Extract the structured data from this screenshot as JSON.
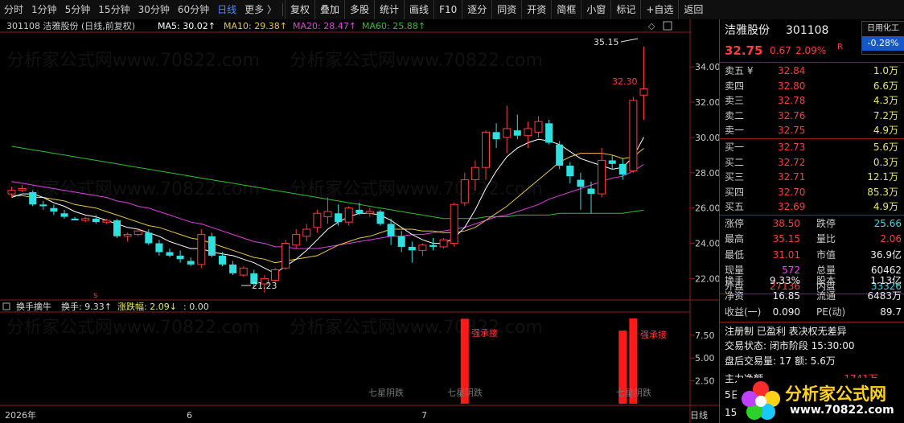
{
  "toolbar": {
    "periods": [
      "分时",
      "1分钟",
      "5分钟",
      "15分钟",
      "30分钟",
      "60分钟",
      "日线",
      "更多 〉"
    ],
    "active_period": "日线",
    "buttons": [
      "复权",
      "叠加",
      "多股",
      "统计",
      "画线",
      "F10",
      "逐分",
      "同资",
      "开资",
      "简框",
      "小窗",
      "标记",
      "+自选",
      "返回"
    ]
  },
  "chart_header": {
    "title": "301108 洁雅股份 (日线,前复权)",
    "ma5": "MA5: 30.02↑",
    "ma10": "MA10: 29.38↑",
    "ma20": "MA20: 28.47↑",
    "ma60": "MA60: 25.88↑"
  },
  "watermark": "分析家公式网www.70822.com",
  "annotations": {
    "high": "35.15",
    "low": "21.23",
    "limit_up": "32.30",
    "s_marker": "s"
  },
  "indicator_header": {
    "name": "换手擒牛",
    "turnover": "换手: 9.33↑",
    "change": "涨跌幅: 2.09↓",
    "blank": ": 0.00"
  },
  "indicator_labels": {
    "strong_accept": "强承接",
    "dark_star": "七星阴跌"
  },
  "x_axis": {
    "labels": [
      "2026年",
      "6",
      "7"
    ],
    "period_label": "日线"
  },
  "colors": {
    "up": "#ff3c3c",
    "down": "#2fe0e0",
    "ma5": "#ffffff",
    "ma10": "#e8c840",
    "ma20": "#e040e0",
    "ma60": "#30c030"
  },
  "chart_data": [
    {
      "type": "candlestick",
      "y_ticks": [
        "34.00",
        "32.00",
        "30.00",
        "28.00",
        "26.00",
        "24.00",
        "22.00"
      ],
      "ylim": [
        21.2,
        35.6
      ],
      "candles": [
        {
          "o": 26.8,
          "h": 27.2,
          "l": 26.6,
          "c": 27.0
        },
        {
          "o": 27.0,
          "h": 27.3,
          "l": 26.9,
          "c": 27.1
        },
        {
          "o": 26.9,
          "h": 27.0,
          "l": 26.1,
          "c": 26.2
        },
        {
          "o": 26.2,
          "h": 26.4,
          "l": 25.9,
          "c": 26.1
        },
        {
          "o": 26.0,
          "h": 26.2,
          "l": 25.6,
          "c": 25.8
        },
        {
          "o": 25.7,
          "h": 25.9,
          "l": 25.4,
          "c": 25.5
        },
        {
          "o": 25.4,
          "h": 25.5,
          "l": 25.3,
          "c": 25.3
        },
        {
          "o": 25.3,
          "h": 25.5,
          "l": 25.2,
          "c": 25.4
        },
        {
          "o": 25.4,
          "h": 25.6,
          "l": 25.1,
          "c": 25.2
        },
        {
          "o": 25.2,
          "h": 25.4,
          "l": 25.1,
          "c": 25.3
        },
        {
          "o": 25.3,
          "h": 25.4,
          "l": 24.3,
          "c": 24.4
        },
        {
          "o": 24.4,
          "h": 24.6,
          "l": 24.1,
          "c": 24.5
        },
        {
          "o": 24.5,
          "h": 24.8,
          "l": 24.4,
          "c": 24.7
        },
        {
          "o": 24.6,
          "h": 24.8,
          "l": 23.9,
          "c": 24.0
        },
        {
          "o": 24.0,
          "h": 24.2,
          "l": 23.3,
          "c": 23.5
        },
        {
          "o": 23.5,
          "h": 23.7,
          "l": 23.2,
          "c": 23.3
        },
        {
          "o": 23.3,
          "h": 23.6,
          "l": 22.9,
          "c": 23.1
        },
        {
          "o": 23.0,
          "h": 23.2,
          "l": 22.7,
          "c": 22.8
        },
        {
          "o": 22.8,
          "h": 24.8,
          "l": 22.6,
          "c": 24.5
        },
        {
          "o": 24.4,
          "h": 24.6,
          "l": 23.2,
          "c": 23.3
        },
        {
          "o": 23.3,
          "h": 23.5,
          "l": 22.7,
          "c": 22.8
        },
        {
          "o": 22.8,
          "h": 23.0,
          "l": 22.2,
          "c": 22.3
        },
        {
          "o": 22.2,
          "h": 22.7,
          "l": 22.1,
          "c": 22.6
        },
        {
          "o": 22.3,
          "h": 22.5,
          "l": 21.5,
          "c": 21.7
        },
        {
          "o": 21.7,
          "h": 22.2,
          "l": 21.2,
          "c": 22.0
        },
        {
          "o": 21.9,
          "h": 22.6,
          "l": 21.8,
          "c": 22.5
        },
        {
          "o": 22.6,
          "h": 24.2,
          "l": 22.5,
          "c": 24.0
        },
        {
          "o": 23.9,
          "h": 24.8,
          "l": 23.7,
          "c": 24.5
        },
        {
          "o": 24.4,
          "h": 25.1,
          "l": 24.1,
          "c": 24.8
        },
        {
          "o": 24.9,
          "h": 25.9,
          "l": 24.6,
          "c": 25.7
        },
        {
          "o": 25.5,
          "h": 26.6,
          "l": 25.1,
          "c": 25.8
        },
        {
          "o": 25.7,
          "h": 26.2,
          "l": 25.0,
          "c": 25.2
        },
        {
          "o": 25.2,
          "h": 26.1,
          "l": 25.0,
          "c": 26.0
        },
        {
          "o": 25.9,
          "h": 26.3,
          "l": 25.6,
          "c": 25.7
        },
        {
          "o": 25.7,
          "h": 26.0,
          "l": 25.5,
          "c": 25.8
        },
        {
          "o": 25.8,
          "h": 25.9,
          "l": 25.0,
          "c": 25.1
        },
        {
          "o": 25.1,
          "h": 25.4,
          "l": 23.9,
          "c": 24.4
        },
        {
          "o": 24.4,
          "h": 24.7,
          "l": 23.5,
          "c": 23.8
        },
        {
          "o": 23.8,
          "h": 24.1,
          "l": 22.9,
          "c": 23.6
        },
        {
          "o": 23.6,
          "h": 24.0,
          "l": 23.3,
          "c": 23.9
        },
        {
          "o": 23.9,
          "h": 24.3,
          "l": 23.6,
          "c": 23.8
        },
        {
          "o": 23.8,
          "h": 24.3,
          "l": 23.7,
          "c": 24.2
        },
        {
          "o": 24.0,
          "h": 26.3,
          "l": 23.8,
          "c": 26.2
        },
        {
          "o": 26.3,
          "h": 28.0,
          "l": 26.1,
          "c": 27.6
        },
        {
          "o": 27.6,
          "h": 28.7,
          "l": 27.0,
          "c": 28.3
        },
        {
          "o": 28.3,
          "h": 30.4,
          "l": 27.6,
          "c": 30.3
        },
        {
          "o": 30.3,
          "h": 30.8,
          "l": 29.4,
          "c": 29.9
        },
        {
          "o": 30.0,
          "h": 31.8,
          "l": 29.1,
          "c": 30.5
        },
        {
          "o": 30.4,
          "h": 31.3,
          "l": 29.9,
          "c": 30.1
        },
        {
          "o": 30.1,
          "h": 30.9,
          "l": 29.4,
          "c": 30.5
        },
        {
          "o": 30.3,
          "h": 31.2,
          "l": 30.0,
          "c": 30.9
        },
        {
          "o": 30.8,
          "h": 31.0,
          "l": 29.6,
          "c": 29.7
        },
        {
          "o": 29.6,
          "h": 29.8,
          "l": 28.2,
          "c": 28.4
        },
        {
          "o": 28.4,
          "h": 28.6,
          "l": 27.4,
          "c": 27.8
        },
        {
          "o": 27.6,
          "h": 28.0,
          "l": 25.9,
          "c": 27.2
        },
        {
          "o": 27.1,
          "h": 27.5,
          "l": 25.7,
          "c": 26.8
        },
        {
          "o": 26.8,
          "h": 29.4,
          "l": 26.6,
          "c": 28.7
        },
        {
          "o": 28.7,
          "h": 29.0,
          "l": 28.2,
          "c": 28.5
        },
        {
          "o": 28.5,
          "h": 28.8,
          "l": 27.6,
          "c": 27.9
        },
        {
          "o": 28.1,
          "h": 32.3,
          "l": 28.0,
          "c": 32.1
        },
        {
          "o": 32.4,
          "h": 35.15,
          "l": 31.0,
          "c": 32.75
        }
      ],
      "ma5": [
        26.6,
        26.8,
        26.8,
        26.6,
        26.3,
        26.1,
        25.8,
        25.6,
        25.5,
        25.3,
        25.1,
        24.9,
        24.8,
        24.6,
        24.4,
        24.1,
        23.9,
        23.7,
        23.7,
        23.5,
        23.4,
        23.3,
        23.1,
        22.9,
        22.6,
        22.3,
        22.7,
        23.1,
        23.6,
        24.2,
        24.8,
        25.2,
        25.5,
        25.7,
        25.7,
        25.6,
        25.3,
        24.9,
        24.5,
        24.2,
        24.0,
        24.0,
        24.3,
        24.9,
        25.9,
        27.1,
        28.1,
        28.9,
        29.4,
        29.7,
        29.9,
        29.8,
        29.6,
        29.2,
        28.8,
        28.6,
        28.4,
        28.2,
        28.3,
        28.9,
        30.02
      ],
      "ma10": [
        26.7,
        26.7,
        26.6,
        26.6,
        26.5,
        26.4,
        26.2,
        26.1,
        26.0,
        25.8,
        25.6,
        25.4,
        25.2,
        25.0,
        24.9,
        24.7,
        24.5,
        24.3,
        24.2,
        24.0,
        23.8,
        23.6,
        23.4,
        23.2,
        23.1,
        22.9,
        23.0,
        23.1,
        23.2,
        23.3,
        23.6,
        23.9,
        24.1,
        24.3,
        24.4,
        24.6,
        24.8,
        24.8,
        24.8,
        24.7,
        24.7,
        24.6,
        24.6,
        24.7,
        24.9,
        25.3,
        25.7,
        26.1,
        26.6,
        27.1,
        27.6,
        28.1,
        28.6,
        28.9,
        29.1,
        29.1,
        29.1,
        29.0,
        28.8,
        28.9,
        29.38
      ],
      "ma20": [
        27.5,
        27.4,
        27.3,
        27.2,
        27.1,
        27.0,
        26.9,
        26.8,
        26.7,
        26.6,
        26.4,
        26.3,
        26.1,
        26.0,
        25.8,
        25.6,
        25.4,
        25.2,
        25.1,
        24.9,
        24.7,
        24.5,
        24.3,
        24.1,
        24.0,
        23.8,
        23.8,
        23.7,
        23.7,
        23.7,
        23.8,
        23.9,
        24.0,
        24.1,
        24.2,
        24.3,
        24.4,
        24.4,
        24.5,
        24.5,
        24.6,
        24.7,
        24.8,
        24.9,
        25.1,
        25.3,
        25.5,
        25.6,
        25.8,
        26.0,
        26.2,
        26.5,
        26.7,
        26.9,
        27.1,
        27.3,
        27.5,
        27.7,
        27.8,
        28.1,
        28.47
      ],
      "ma60": [
        29.5,
        29.4,
        29.3,
        29.2,
        29.1,
        29.0,
        28.9,
        28.8,
        28.7,
        28.6,
        28.5,
        28.4,
        28.3,
        28.2,
        28.1,
        28.0,
        27.9,
        27.8,
        27.7,
        27.6,
        27.5,
        27.4,
        27.3,
        27.2,
        27.1,
        27.0,
        26.9,
        26.8,
        26.7,
        26.6,
        26.5,
        26.4,
        26.3,
        26.2,
        26.1,
        26.0,
        25.9,
        25.8,
        25.7,
        25.6,
        25.5,
        25.4,
        25.4,
        25.4,
        25.4,
        25.5,
        25.5,
        25.5,
        25.6,
        25.6,
        25.6,
        25.6,
        25.7,
        25.7,
        25.7,
        25.7,
        25.7,
        25.7,
        25.7,
        25.8,
        25.88
      ]
    },
    {
      "type": "bar",
      "y_ticks": [
        "7.50",
        "5.00",
        "2.50"
      ],
      "ylim": [
        0,
        9.33
      ],
      "bars": [
        {
          "index": 43,
          "value": 9.3
        },
        {
          "index": 58,
          "value": 8.0
        },
        {
          "index": 59,
          "value": 9.33
        }
      ]
    }
  ],
  "quote_panel": {
    "name": "洁雅股份",
    "code": "301108",
    "sector_label": "日用化工",
    "sector_change": "-0.28%",
    "price": "32.75",
    "change": "0.67",
    "pct": "2.09%",
    "r_badge": "R",
    "sells": [
      {
        "label": "卖五 ¥",
        "price": "32.84",
        "vol": "1.0万"
      },
      {
        "label": "卖四",
        "price": "32.80",
        "vol": "6.6万"
      },
      {
        "label": "卖三",
        "price": "32.78",
        "vol": "4.3万"
      },
      {
        "label": "卖二",
        "price": "32.76",
        "vol": "7.2万"
      },
      {
        "label": "卖一",
        "price": "32.75",
        "vol": "4.9万"
      }
    ],
    "buys": [
      {
        "label": "买一",
        "price": "32.73",
        "vol": "5.6万"
      },
      {
        "label": "买二",
        "price": "32.72",
        "vol": "0.3万"
      },
      {
        "label": "买三",
        "price": "32.71",
        "vol": "12.1万"
      },
      {
        "label": "买四",
        "price": "32.70",
        "vol": "85.3万"
      },
      {
        "label": "买五",
        "price": "32.69",
        "vol": "4.9万"
      }
    ],
    "stats": [
      {
        "l1": "涨停",
        "v1": "38.50",
        "c1": "red",
        "l2": "跌停",
        "v2": "25.66",
        "c2": "green"
      },
      {
        "l1": "最高",
        "v1": "35.15",
        "c1": "red",
        "l2": "量比",
        "v2": "2.06",
        "c2": "red"
      },
      {
        "l1": "最低",
        "v1": "31.01",
        "c1": "red",
        "l2": "市值",
        "v2": "36.9亿",
        "c2": "white"
      },
      {
        "l1": "现量",
        "v1": "572",
        "c1": "magenta",
        "l2": "总量",
        "v2": "60462",
        "c2": "white"
      },
      {
        "l1": "外盘",
        "v1": "27136",
        "c1": "red",
        "l2": "内盘",
        "v2": "33326",
        "c2": "green"
      }
    ],
    "fundamentals": [
      {
        "l1": "换手",
        "v1": "9.33%",
        "l2": "股本",
        "v2": "1.13亿"
      },
      {
        "l1": "净资",
        "v1": "16.85",
        "l2": "流通",
        "v2": "6483万"
      },
      {
        "l1": "收益(一)",
        "v1": "0.090",
        "l2": "PE(动)",
        "v2": "89.7"
      }
    ],
    "tags": "注册制 已盈利 表决权无差异",
    "trade_status": "交易状态: 闭市阶段 15:30:00",
    "after_hours": "盘后交易量: 17  额: 5.6万",
    "partial_1": "主力净额",
    "partial_1_val": "-1741万",
    "partial_2": "5日",
    "partial_3": "15"
  },
  "logo": {
    "text": "分析家公式网",
    "url": "www.70822.com"
  }
}
